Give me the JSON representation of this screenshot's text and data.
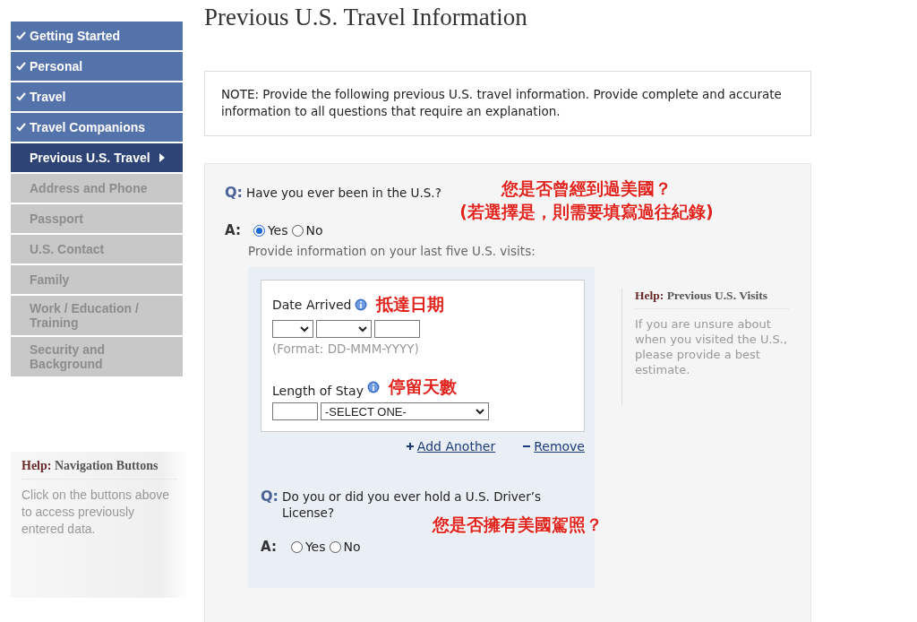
{
  "sidebar": {
    "items": [
      {
        "label": "Getting Started",
        "kind": "done",
        "selected": false
      },
      {
        "label": "Personal",
        "kind": "done",
        "selected": false
      },
      {
        "label": "Travel",
        "kind": "done",
        "selected": false
      },
      {
        "label": "Travel Companions",
        "kind": "done",
        "selected": false
      },
      {
        "label": "Previous U.S. Travel",
        "kind": "current",
        "selected": true
      },
      {
        "label": "Address and Phone",
        "kind": "pending",
        "selected": false
      },
      {
        "label": "Passport",
        "kind": "pending",
        "selected": false
      },
      {
        "label": "U.S. Contact",
        "kind": "pending",
        "selected": false
      },
      {
        "label": "Family",
        "kind": "pending",
        "selected": false
      },
      {
        "label": "Work / Education / Training",
        "kind": "pending",
        "selected": false
      },
      {
        "label": "Security and Background",
        "kind": "pending",
        "selected": false
      }
    ],
    "help": {
      "prefix": "Help:",
      "title": "Navigation Buttons",
      "text": "Click on the buttons above to access previously entered data."
    }
  },
  "page_title": "Previous U.S. Travel Information",
  "note": "NOTE: Provide the following previous U.S. travel information. Provide complete and accurate information to all questions that require an explanation.",
  "question_1": {
    "q_label": "Q:",
    "question": "Have you ever been in the U.S.?",
    "annotation": [
      "您是否曾經到過美國？",
      "(若選擇是，則需要填寫過往紀錄)"
    ],
    "a_label": "A:",
    "options": [
      {
        "label": "Yes",
        "selected": true
      },
      {
        "label": "No",
        "selected": false
      }
    ],
    "instruction": "Provide information on your last five U.S. visits:"
  },
  "visit": {
    "date_label": "Date Arrived",
    "date_annotation": "抵達日期",
    "format_hint": "(Format: DD-MMM-YYYY)",
    "stay_label": "Length of Stay",
    "stay_annotation": "停留天數",
    "stay_unit": "-SELECT ONE-"
  },
  "actions": [
    {
      "kind": "add",
      "label": "Add Another"
    },
    {
      "kind": "remove",
      "label": "Remove"
    }
  ],
  "question_2": {
    "q_label": "Q:",
    "question": "Do you or did you ever hold a U.S. Driver’s License?",
    "annotation": "您是否擁有美國駕照？",
    "a_label": "A:",
    "options": [
      {
        "label": "Yes",
        "selected": false
      },
      {
        "label": "No",
        "selected": false
      }
    ]
  },
  "visits_help": {
    "prefix": "Help:",
    "title": "Previous U.S. Visits",
    "text": "If you are unsure about when you visited the U.S., please provide a best estimate."
  }
}
